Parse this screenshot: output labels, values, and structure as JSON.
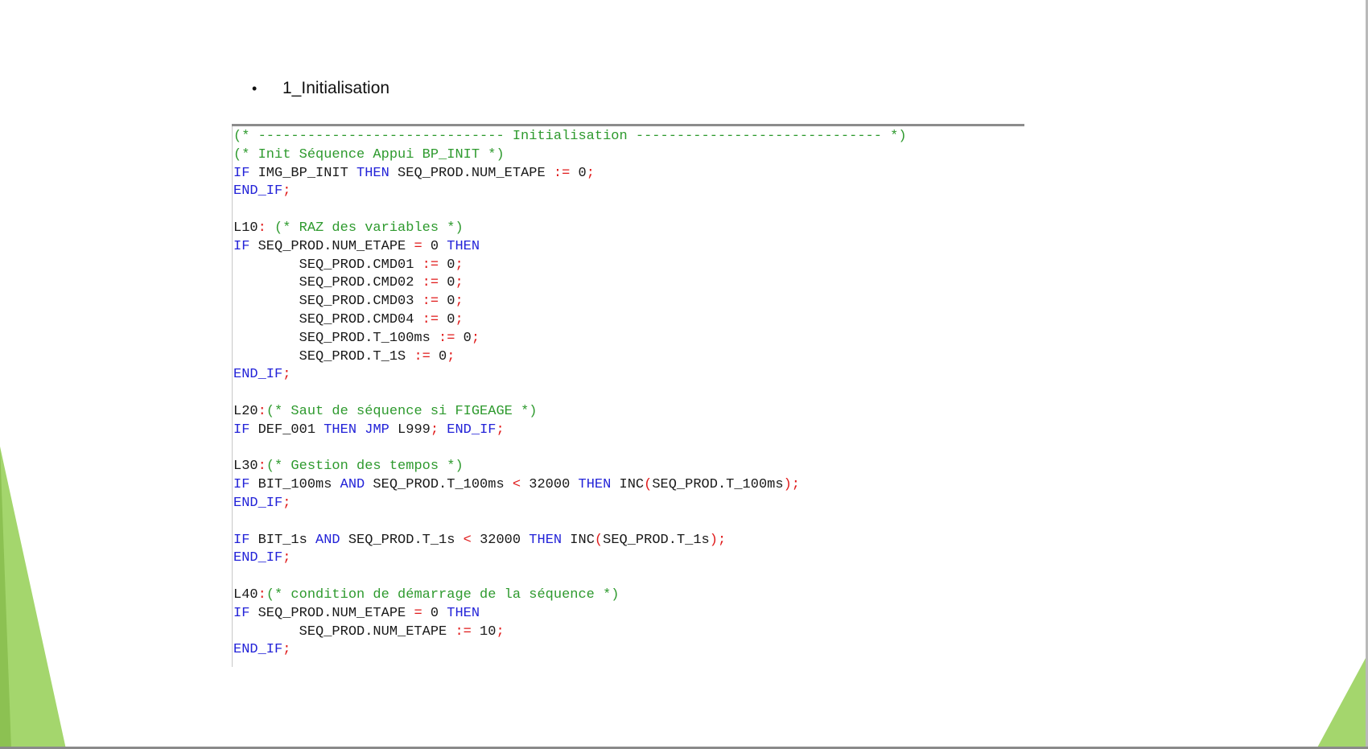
{
  "slide": {
    "bullet": "•",
    "heading": "1_Initialisation",
    "accent_color": "#a0d468"
  },
  "code": {
    "colors": {
      "comment": "#2e9a2e",
      "keyword": "#2323d8",
      "operator": "#e01a1a",
      "text": "#1a1a1a"
    },
    "lines": [
      [
        [
          "c",
          "(* ------------------------------ Initialisation ------------------------------ *)"
        ]
      ],
      [
        [
          "c",
          "(* Init Séquence Appui BP_INIT *)"
        ]
      ],
      [
        [
          "k",
          "IF"
        ],
        [
          "t",
          " IMG_BP_INIT "
        ],
        [
          "k",
          "THEN"
        ],
        [
          "t",
          " SEQ_PROD.NUM_ETAPE "
        ],
        [
          "o",
          ":="
        ],
        [
          "t",
          " 0"
        ],
        [
          "o",
          ";"
        ]
      ],
      [
        [
          "k",
          "END_IF"
        ],
        [
          "o",
          ";"
        ]
      ],
      [],
      [
        [
          "t",
          "L10"
        ],
        [
          "o",
          ":"
        ],
        [
          "c",
          " (* RAZ des variables *)"
        ]
      ],
      [
        [
          "k",
          "IF"
        ],
        [
          "t",
          " SEQ_PROD.NUM_ETAPE "
        ],
        [
          "o",
          "="
        ],
        [
          "t",
          " 0 "
        ],
        [
          "k",
          "THEN"
        ]
      ],
      [
        [
          "t",
          "        SEQ_PROD.CMD01 "
        ],
        [
          "o",
          ":="
        ],
        [
          "t",
          " 0"
        ],
        [
          "o",
          ";"
        ]
      ],
      [
        [
          "t",
          "        SEQ_PROD.CMD02 "
        ],
        [
          "o",
          ":="
        ],
        [
          "t",
          " 0"
        ],
        [
          "o",
          ";"
        ]
      ],
      [
        [
          "t",
          "        SEQ_PROD.CMD03 "
        ],
        [
          "o",
          ":="
        ],
        [
          "t",
          " 0"
        ],
        [
          "o",
          ";"
        ]
      ],
      [
        [
          "t",
          "        SEQ_PROD.CMD04 "
        ],
        [
          "o",
          ":="
        ],
        [
          "t",
          " 0"
        ],
        [
          "o",
          ";"
        ]
      ],
      [
        [
          "t",
          "        SEQ_PROD.T_100ms "
        ],
        [
          "o",
          ":="
        ],
        [
          "t",
          " 0"
        ],
        [
          "o",
          ";"
        ]
      ],
      [
        [
          "t",
          "        SEQ_PROD.T_1S "
        ],
        [
          "o",
          ":="
        ],
        [
          "t",
          " 0"
        ],
        [
          "o",
          ";"
        ]
      ],
      [
        [
          "k",
          "END_IF"
        ],
        [
          "o",
          ";"
        ]
      ],
      [],
      [
        [
          "t",
          "L20"
        ],
        [
          "o",
          ":"
        ],
        [
          "c",
          "(* Saut de séquence si FIGEAGE *)"
        ]
      ],
      [
        [
          "k",
          "IF"
        ],
        [
          "t",
          " DEF_001 "
        ],
        [
          "k",
          "THEN"
        ],
        [
          "t",
          " "
        ],
        [
          "k",
          "JMP"
        ],
        [
          "t",
          " L999"
        ],
        [
          "o",
          ";"
        ],
        [
          "t",
          " "
        ],
        [
          "k",
          "END_IF"
        ],
        [
          "o",
          ";"
        ]
      ],
      [],
      [
        [
          "t",
          "L30"
        ],
        [
          "o",
          ":"
        ],
        [
          "c",
          "(* Gestion des tempos *)"
        ]
      ],
      [
        [
          "k",
          "IF"
        ],
        [
          "t",
          " BIT_100ms "
        ],
        [
          "k",
          "AND"
        ],
        [
          "t",
          " SEQ_PROD.T_100ms "
        ],
        [
          "o",
          "<"
        ],
        [
          "t",
          " 32000 "
        ],
        [
          "k",
          "THEN"
        ],
        [
          "t",
          " INC"
        ],
        [
          "o",
          "("
        ],
        [
          "t",
          "SEQ_PROD.T_100ms"
        ],
        [
          "o",
          ");"
        ]
      ],
      [
        [
          "k",
          "END_IF"
        ],
        [
          "o",
          ";"
        ]
      ],
      [],
      [
        [
          "k",
          "IF"
        ],
        [
          "t",
          " BIT_1s "
        ],
        [
          "k",
          "AND"
        ],
        [
          "t",
          " SEQ_PROD.T_1s "
        ],
        [
          "o",
          "<"
        ],
        [
          "t",
          " 32000 "
        ],
        [
          "k",
          "THEN"
        ],
        [
          "t",
          " INC"
        ],
        [
          "o",
          "("
        ],
        [
          "t",
          "SEQ_PROD.T_1s"
        ],
        [
          "o",
          ");"
        ]
      ],
      [
        [
          "k",
          "END_IF"
        ],
        [
          "o",
          ";"
        ]
      ],
      [],
      [
        [
          "t",
          "L40"
        ],
        [
          "o",
          ":"
        ],
        [
          "c",
          "(* condition de démarrage de la séquence *)"
        ]
      ],
      [
        [
          "k",
          "IF"
        ],
        [
          "t",
          " SEQ_PROD.NUM_ETAPE "
        ],
        [
          "o",
          "="
        ],
        [
          "t",
          " 0 "
        ],
        [
          "k",
          "THEN"
        ]
      ],
      [
        [
          "t",
          "        SEQ_PROD.NUM_ETAPE "
        ],
        [
          "o",
          ":="
        ],
        [
          "t",
          " 10"
        ],
        [
          "o",
          ";"
        ]
      ],
      [
        [
          "k",
          "END_IF"
        ],
        [
          "o",
          ";"
        ]
      ]
    ]
  }
}
